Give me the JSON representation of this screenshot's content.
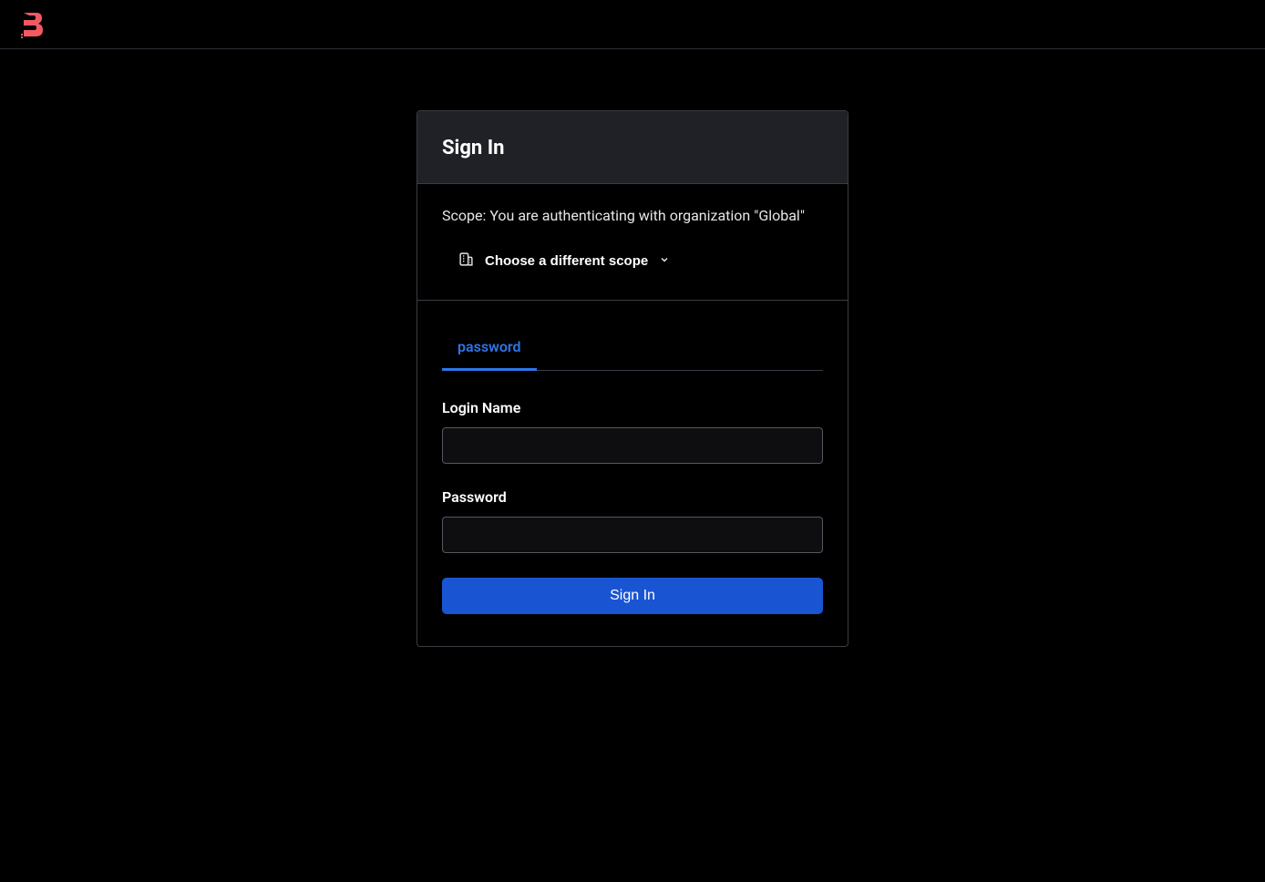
{
  "header": {
    "logo_name": "app-logo"
  },
  "card": {
    "title": "Sign In",
    "scope": {
      "text": "Scope: You are authenticating with organization \"Global\"",
      "button_label": "Choose a different scope"
    },
    "tabs": [
      {
        "label": "password",
        "active": true
      }
    ],
    "form": {
      "login_label": "Login Name",
      "login_value": "",
      "password_label": "Password",
      "password_value": "",
      "submit_label": "Sign In"
    }
  },
  "colors": {
    "accent": "#1955d2",
    "tab_active": "#2e75e8",
    "logo": "#f35963"
  }
}
